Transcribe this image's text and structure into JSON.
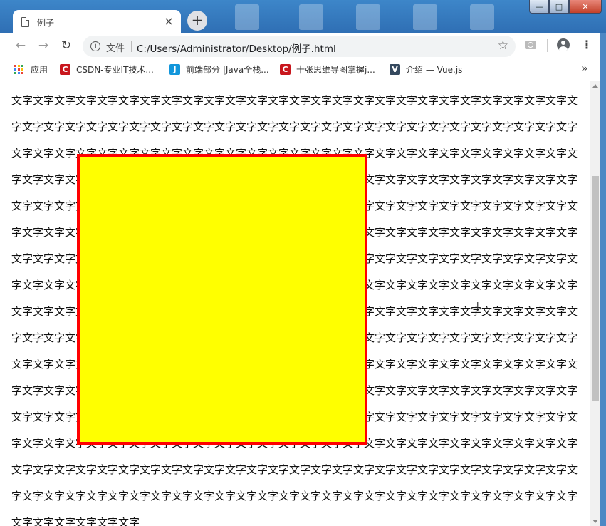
{
  "window": {
    "minimize_label": "—",
    "maximize_label": "□",
    "close_label": "✕"
  },
  "tab": {
    "title": "例子",
    "close_label": "×",
    "new_tab_label": "+"
  },
  "toolbar": {
    "back_label": "←",
    "forward_label": "→",
    "reload_label": "↻",
    "omnibox_file_label": "文件",
    "url": "C:/Users/Administrator/Desktop/例子.html",
    "star_label": "☆",
    "menu_label": "⋮"
  },
  "bookmarks": {
    "apps_label": "应用",
    "items": [
      {
        "label": "CSDN-专业IT技术...",
        "icon": "C",
        "color": "#c8161d"
      },
      {
        "label": "前端部分 |Java全栈...",
        "icon": "J",
        "color": "#1296db"
      },
      {
        "label": "十张思维导图掌握j...",
        "icon": "C",
        "color": "#c8161d"
      },
      {
        "label": "介绍 — Vue.js",
        "icon": "V",
        "color": "#35495e"
      }
    ],
    "more_label": "»"
  },
  "page": {
    "filler_text": "文字"
  },
  "colors": {
    "box_fill": "#ffff00",
    "box_border": "#ff0000"
  }
}
